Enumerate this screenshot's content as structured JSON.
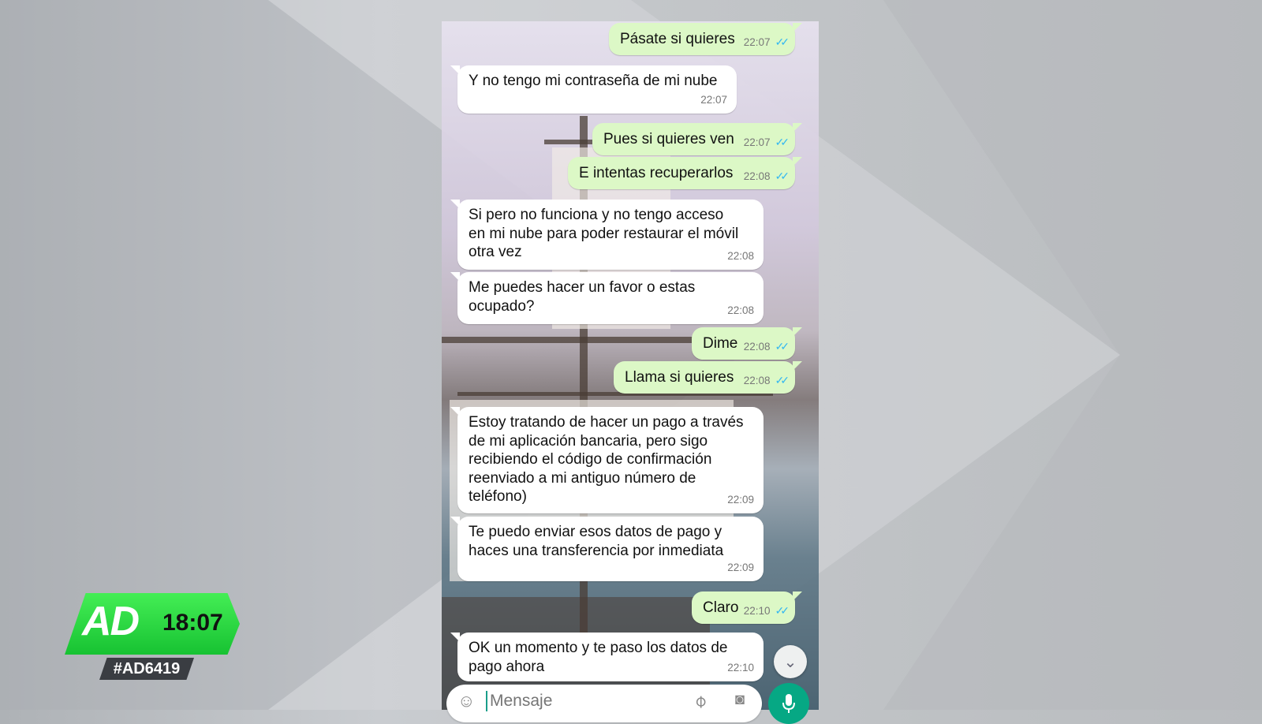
{
  "chat": {
    "messages": [
      {
        "dir": "out",
        "text": "Pásate si quieres",
        "time": "22:07",
        "ticks": "✓✓"
      },
      {
        "dir": "in",
        "text": "Y no tengo mi contraseña de mi nube",
        "time": "22:07"
      },
      {
        "dir": "out",
        "text": "Pues si quieres ven",
        "time": "22:07",
        "ticks": "✓✓"
      },
      {
        "dir": "out",
        "text": "E intentas recuperarlos",
        "time": "22:08",
        "ticks": "✓✓"
      },
      {
        "dir": "in",
        "lines": [
          "Si pero no funciona y no tengo acceso",
          "en mi nube para poder restaurar el móvil",
          "otra vez"
        ],
        "time": "22:08"
      },
      {
        "dir": "in",
        "lines": [
          "Me puedes hacer un favor o estas",
          "ocupado?"
        ],
        "time": "22:08"
      },
      {
        "dir": "out",
        "text": "Dime",
        "time": "22:08",
        "ticks": "✓✓"
      },
      {
        "dir": "out",
        "text": "Llama si quieres",
        "time": "22:08",
        "ticks": "✓✓"
      },
      {
        "dir": "in",
        "lines": [
          "Estoy tratando de hacer un pago a través",
          "de mi aplicación bancaria, pero sigo",
          "recibiendo el código de confirmación",
          "reenviado a mi antiguo número de",
          "teléfono)"
        ],
        "time": "22:09"
      },
      {
        "dir": "in",
        "lines": [
          "Te puedo enviar esos datos de pago y",
          "haces una transferencia por inmediata"
        ],
        "time": "22:09"
      },
      {
        "dir": "out",
        "text": "Claro",
        "time": "22:10",
        "ticks": "✓✓"
      },
      {
        "dir": "in",
        "lines": [
          "OK un momento y te paso los datos de",
          "pago ahora"
        ],
        "time": "22:10"
      }
    ],
    "input_placeholder": "Mensaje",
    "icons": {
      "emoji": "emoji-icon",
      "attach": "paperclip-icon",
      "camera": "camera-icon",
      "mic": "mic-icon",
      "scroll": "double-chevron-down-icon"
    }
  },
  "broadcast": {
    "logo": "AD",
    "clock": "18:07",
    "hashtag": "#AD6419",
    "accent": "#22cc3a"
  }
}
